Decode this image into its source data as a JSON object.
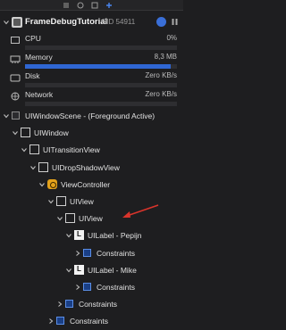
{
  "toolbar": {
    "icons": [
      "list-icon",
      "compass-icon",
      "processes-icon",
      "debug-memory-icon"
    ],
    "active": "debug-memory-icon"
  },
  "process": {
    "name": "FrameDebugTutorial",
    "pid": "PID 54911"
  },
  "gauges": [
    {
      "label": "CPU",
      "value": "0%",
      "fill": 0.0
    },
    {
      "label": "Memory",
      "value": "8,3 MB",
      "fill": 0.96
    },
    {
      "label": "Disk",
      "value": "Zero KB/s",
      "fill": 0.0
    },
    {
      "label": "Network",
      "value": "Zero KB/s",
      "fill": 0.0
    }
  ],
  "tree": [
    {
      "label": "UIWindowScene - (Foreground Active)",
      "depth": 0,
      "kind": "small"
    },
    {
      "label": "UIWindow",
      "depth": 1,
      "kind": "box"
    },
    {
      "label": "UITransitionView",
      "depth": 2,
      "kind": "box"
    },
    {
      "label": "UIDropShadowView",
      "depth": 3,
      "kind": "box"
    },
    {
      "label": "ViewController",
      "depth": 4,
      "kind": "vc"
    },
    {
      "label": "UIView",
      "depth": 5,
      "kind": "box"
    },
    {
      "label": "UIView",
      "depth": 6,
      "kind": "box"
    },
    {
      "label": "UILabel - Pepijn",
      "depth": 7,
      "kind": "lbl"
    },
    {
      "label": "Constraints",
      "depth": 8,
      "kind": "con"
    },
    {
      "label": "UILabel - Mike",
      "depth": 7,
      "kind": "lbl"
    },
    {
      "label": "Constraints",
      "depth": 8,
      "kind": "con"
    },
    {
      "label": "Constraints",
      "depth": 6,
      "kind": "con"
    },
    {
      "label": "Constraints",
      "depth": 5,
      "kind": "con"
    }
  ],
  "colors": {
    "accent": "#2f66d3",
    "annotation_arrow": "#d9342b",
    "view_controller": "#e3a11b"
  }
}
